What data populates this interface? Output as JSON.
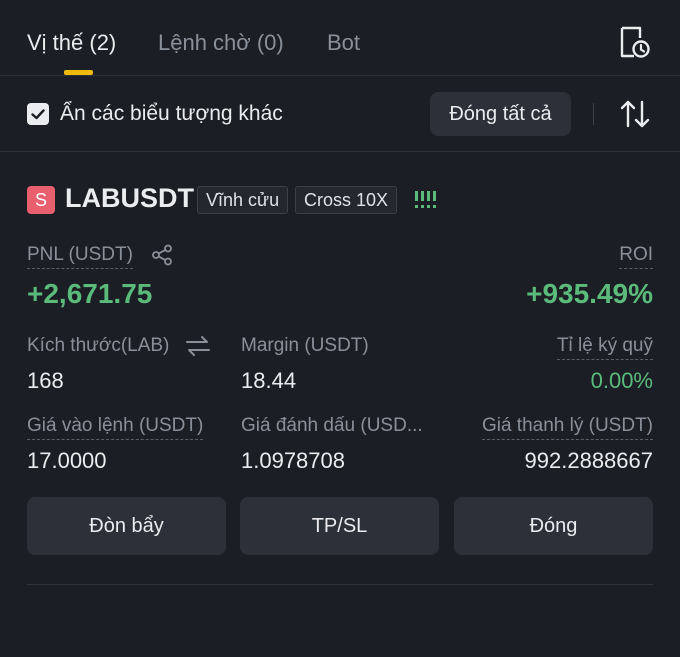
{
  "tabs": [
    {
      "label": "Vị thế (2)",
      "active": true
    },
    {
      "label": "Lệnh chờ (0)",
      "active": false
    },
    {
      "label": "Bot",
      "active": false
    }
  ],
  "filter": {
    "hide_other_symbols_label": "Ẩn các biểu tượng khác",
    "hide_other_symbols_checked": true,
    "close_all_label": "Đóng tất cả"
  },
  "position": {
    "side_letter": "S",
    "symbol": "LABUSDT",
    "contract_type": "Vĩnh cửu",
    "margin_mode_leverage": "Cross 10X",
    "pnl_label": "PNL (USDT)",
    "pnl_value": "+2,671.75",
    "roi_label": "ROI",
    "roi_value": "+935.49%",
    "size_label": "Kích thước(LAB)",
    "size_value": "168",
    "margin_label": "Margin (USDT)",
    "margin_value": "18.44",
    "margin_ratio_label": "Tỉ lệ ký quỹ",
    "margin_ratio_value": "0.00%",
    "entry_price_label": "Giá vào lệnh (USDT)",
    "entry_price_value": "17.0000",
    "mark_price_label": "Giá đánh dấu (USD...",
    "mark_price_value": "1.0978708",
    "liq_price_label": "Giá thanh lý (USDT)",
    "liq_price_value": "992.2888667"
  },
  "actions": {
    "leverage_label": "Đòn bẩy",
    "tpsl_label": "TP/SL",
    "close_label": "Đóng"
  },
  "colors": {
    "background": "#1b1e24",
    "accent": "#f0b90b",
    "profit": "#5bbb7b",
    "short_badge": "#e85f6d",
    "button": "#2b3039"
  },
  "icons": [
    "history-icon",
    "check-icon",
    "sort-icon",
    "signal-strength-icon",
    "share-icon",
    "swap-icon"
  ]
}
